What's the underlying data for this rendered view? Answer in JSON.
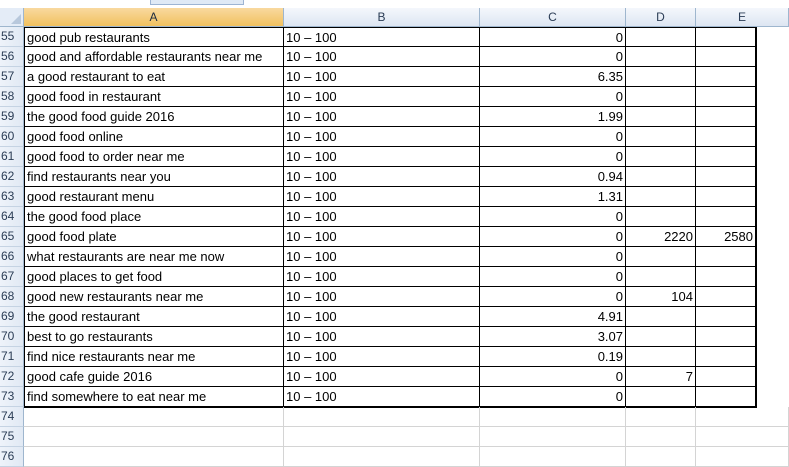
{
  "columns": [
    "A",
    "B",
    "C",
    "D",
    "E"
  ],
  "selected_column": "A",
  "rows": [
    {
      "n": "55",
      "a": "good pub restaurants",
      "b": "10 – 100",
      "c": "0",
      "d": "",
      "e": ""
    },
    {
      "n": "56",
      "a": "good and affordable restaurants near me",
      "b": "10 – 100",
      "c": "0",
      "d": "",
      "e": ""
    },
    {
      "n": "57",
      "a": "a good restaurant to eat",
      "b": "10 – 100",
      "c": "6.35",
      "d": "",
      "e": ""
    },
    {
      "n": "58",
      "a": "good food in restaurant",
      "b": "10 – 100",
      "c": "0",
      "d": "",
      "e": ""
    },
    {
      "n": "59",
      "a": "the good food guide 2016",
      "b": "10 – 100",
      "c": "1.99",
      "d": "",
      "e": ""
    },
    {
      "n": "60",
      "a": "good food online",
      "b": "10 – 100",
      "c": "0",
      "d": "",
      "e": ""
    },
    {
      "n": "61",
      "a": "good food to order near me",
      "b": "10 – 100",
      "c": "0",
      "d": "",
      "e": ""
    },
    {
      "n": "62",
      "a": "find restaurants near you",
      "b": "10 – 100",
      "c": "0.94",
      "d": "",
      "e": ""
    },
    {
      "n": "63",
      "a": "good restaurant menu",
      "b": "10 – 100",
      "c": "1.31",
      "d": "",
      "e": ""
    },
    {
      "n": "64",
      "a": "the good food place",
      "b": "10 – 100",
      "c": "0",
      "d": "",
      "e": ""
    },
    {
      "n": "65",
      "a": "good food plate",
      "b": "10 – 100",
      "c": "0",
      "d": "2220",
      "e": "2580"
    },
    {
      "n": "66",
      "a": "what restaurants are near me now",
      "b": "10 – 100",
      "c": "0",
      "d": "",
      "e": ""
    },
    {
      "n": "67",
      "a": "good places to get food",
      "b": "10 – 100",
      "c": "0",
      "d": "",
      "e": ""
    },
    {
      "n": "68",
      "a": "good new restaurants near me",
      "b": "10 – 100",
      "c": "0",
      "d": "104",
      "e": ""
    },
    {
      "n": "69",
      "a": "the good restaurant",
      "b": "10 – 100",
      "c": "4.91",
      "d": "",
      "e": ""
    },
    {
      "n": "70",
      "a": "best to go restaurants",
      "b": "10 – 100",
      "c": "3.07",
      "d": "",
      "e": ""
    },
    {
      "n": "71",
      "a": "find nice restaurants near me",
      "b": "10 – 100",
      "c": "0.19",
      "d": "",
      "e": ""
    },
    {
      "n": "72",
      "a": "good cafe guide 2016",
      "b": "10 – 100",
      "c": "0",
      "d": "7",
      "e": ""
    },
    {
      "n": "73",
      "a": "find somewhere to eat near me",
      "b": "10 – 100",
      "c": "0",
      "d": "",
      "e": ""
    }
  ],
  "empty_rows": [
    "74",
    "75",
    "76"
  ]
}
